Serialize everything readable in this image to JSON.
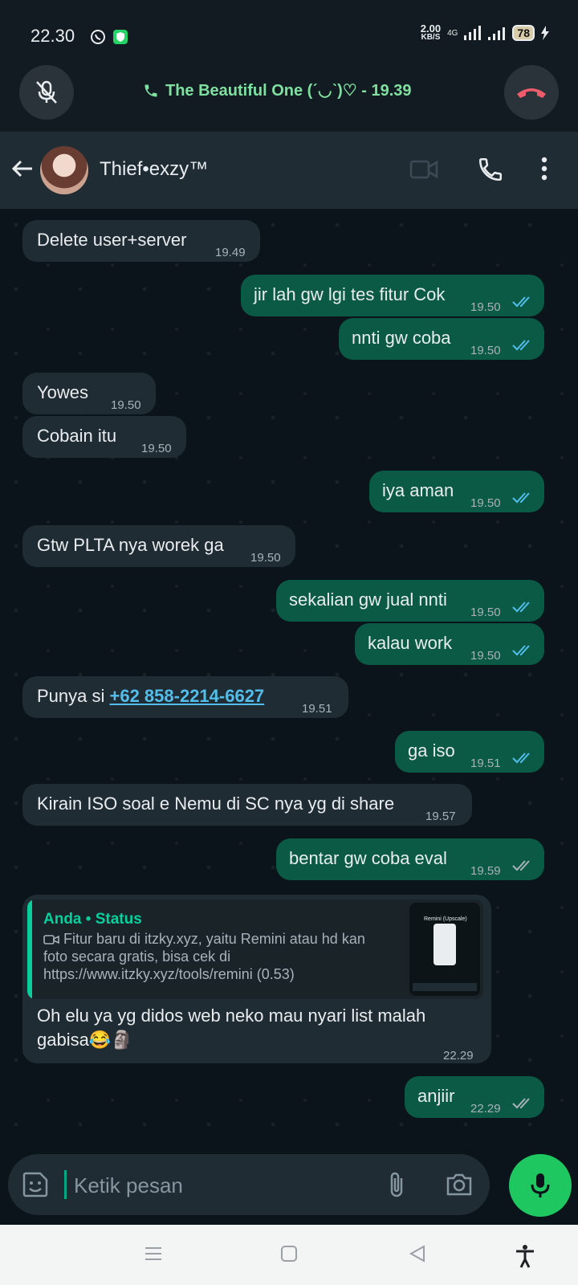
{
  "status_bar": {
    "time": "22.30",
    "net_speed": "2.00",
    "net_unit": "KB/S",
    "network_type": "4G",
    "battery": "78"
  },
  "call_bar": {
    "text": "The Beautiful One (ˊ◡ˋ)♡ - 19.39"
  },
  "header": {
    "contact_name": "Thief•exzy™"
  },
  "messages": [
    {
      "dir": "in",
      "text": "Delete user+server",
      "time": "19.49"
    },
    {
      "dir": "out",
      "text": "jir lah gw lgi tes fitur Cok",
      "time": "19.50"
    },
    {
      "dir": "out",
      "text": "nnti gw coba",
      "time": "19.50"
    },
    {
      "dir": "in",
      "text": "Yowes",
      "time": "19.50"
    },
    {
      "dir": "in",
      "text": "Cobain itu",
      "time": "19.50"
    },
    {
      "dir": "out",
      "text": "iya aman",
      "time": "19.50"
    },
    {
      "dir": "in",
      "text": "Gtw PLTA nya worek ga",
      "time": "19.50"
    },
    {
      "dir": "out",
      "text": "sekalian gw jual nnti",
      "time": "19.50"
    },
    {
      "dir": "out",
      "text": "kalau work",
      "time": "19.50"
    },
    {
      "dir": "in",
      "text_prefix": "Punya si ",
      "link": "+62 858-2214-6627",
      "time": "19.51"
    },
    {
      "dir": "out",
      "text": "ga iso",
      "time": "19.51"
    },
    {
      "dir": "in",
      "text": "Kirain ISO soal e Nemu di SC nya yg di share",
      "time": "19.57"
    },
    {
      "dir": "out",
      "text": "bentar gw coba eval",
      "time": "19.59"
    },
    {
      "dir": "in",
      "quote_title": "Anda • Status",
      "quote_body": "Fitur baru di itzky.xyz, yaitu Remini atau hd kan foto secara gratis, bisa cek di https://www.itzky.xyz/tools/remini (0.53)",
      "quote_thumb_title": "Remini (Upscale)",
      "text": "Oh elu ya yg didos web neko mau nyari list malah gabisa😂🗿",
      "time": "22.29"
    },
    {
      "dir": "out",
      "text": "anjiir",
      "time": "22.29"
    }
  ],
  "input": {
    "placeholder": "Ketik pesan"
  },
  "colors": {
    "accent_green": "#00a884",
    "outgoing_bubble": "#0a5a45",
    "incoming_bubble": "#202c33",
    "read_tick": "#53bdeb",
    "call_text": "#7fe0a0",
    "end_call": "#f15c6d"
  }
}
